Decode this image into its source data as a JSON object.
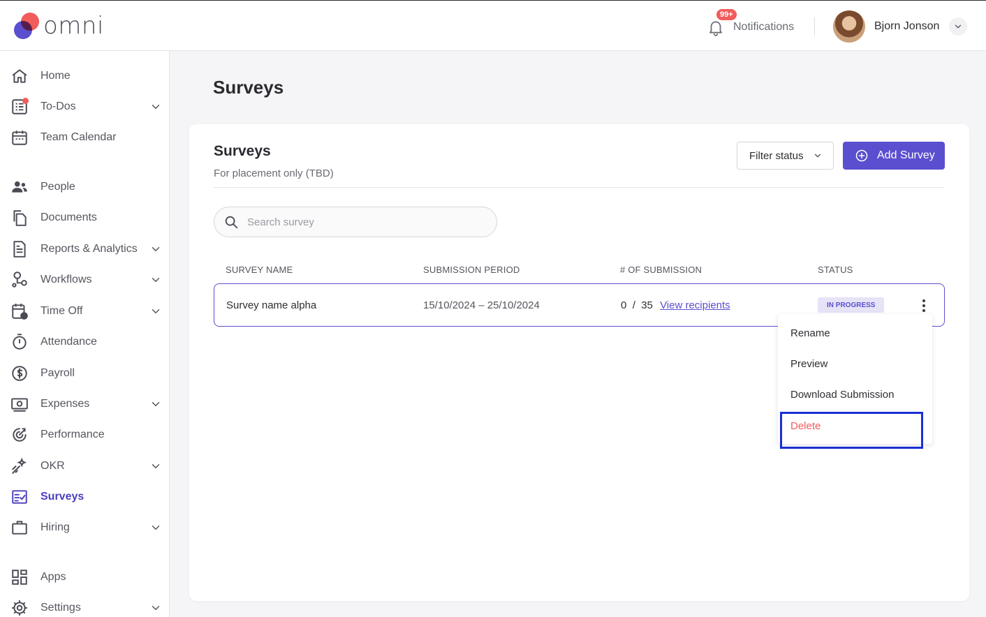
{
  "app": {
    "brand": "omni"
  },
  "header": {
    "notifications": {
      "badge": "99+",
      "label": "Notifications"
    },
    "user": {
      "name": "Bjorn Jonson"
    }
  },
  "sidebar": {
    "items": [
      {
        "label": "Home",
        "icon": "home-icon",
        "has_chevron": false
      },
      {
        "label": "To-Dos",
        "icon": "todo-list-icon",
        "has_chevron": true,
        "has_dot": true
      },
      {
        "label": "Team Calendar",
        "icon": "calendar-icon",
        "has_chevron": false
      },
      {
        "label": "People",
        "icon": "people-icon",
        "has_chevron": false
      },
      {
        "label": "Documents",
        "icon": "documents-icon",
        "has_chevron": false
      },
      {
        "label": "Reports & Analytics",
        "icon": "report-icon",
        "has_chevron": true
      },
      {
        "label": "Workflows",
        "icon": "workflow-icon",
        "has_chevron": true
      },
      {
        "label": "Time Off",
        "icon": "time-off-icon",
        "has_chevron": true
      },
      {
        "label": "Attendance",
        "icon": "stopwatch-icon",
        "has_chevron": false
      },
      {
        "label": "Payroll",
        "icon": "dollar-icon",
        "has_chevron": false
      },
      {
        "label": "Expenses",
        "icon": "expenses-icon",
        "has_chevron": true
      },
      {
        "label": "Performance",
        "icon": "performance-icon",
        "has_chevron": false
      },
      {
        "label": "OKR",
        "icon": "okr-icon",
        "has_chevron": true
      },
      {
        "label": "Surveys",
        "icon": "survey-icon",
        "has_chevron": false,
        "active": true
      },
      {
        "label": "Hiring",
        "icon": "briefcase-icon",
        "has_chevron": true
      },
      {
        "label": "Apps",
        "icon": "apps-grid-icon",
        "has_chevron": false
      },
      {
        "label": "Settings",
        "icon": "gear-icon",
        "has_chevron": true
      }
    ]
  },
  "page": {
    "title": "Surveys"
  },
  "card": {
    "title": "Surveys",
    "subtitle": "For placement only (TBD)",
    "filter_label": "Filter status",
    "add_label": "Add Survey",
    "search_placeholder": "Search survey"
  },
  "table": {
    "headers": [
      "SURVEY NAME",
      "SUBMISSION PERIOD",
      "# OF SUBMISSION",
      "STATUS"
    ],
    "rows": [
      {
        "name": "Survey name alpha",
        "period": "15/10/2024 – 25/10/2024",
        "submitted": "0",
        "separator": "/",
        "total": "35",
        "link": "View recipients",
        "status": "IN PROGRESS"
      }
    ]
  },
  "menu": {
    "items": [
      "Rename",
      "Preview",
      "Download Submission",
      "Delete"
    ]
  },
  "colors": {
    "accent": "#5a4fcf",
    "danger": "#f25c5c",
    "highlight": "#1a2fd4"
  }
}
